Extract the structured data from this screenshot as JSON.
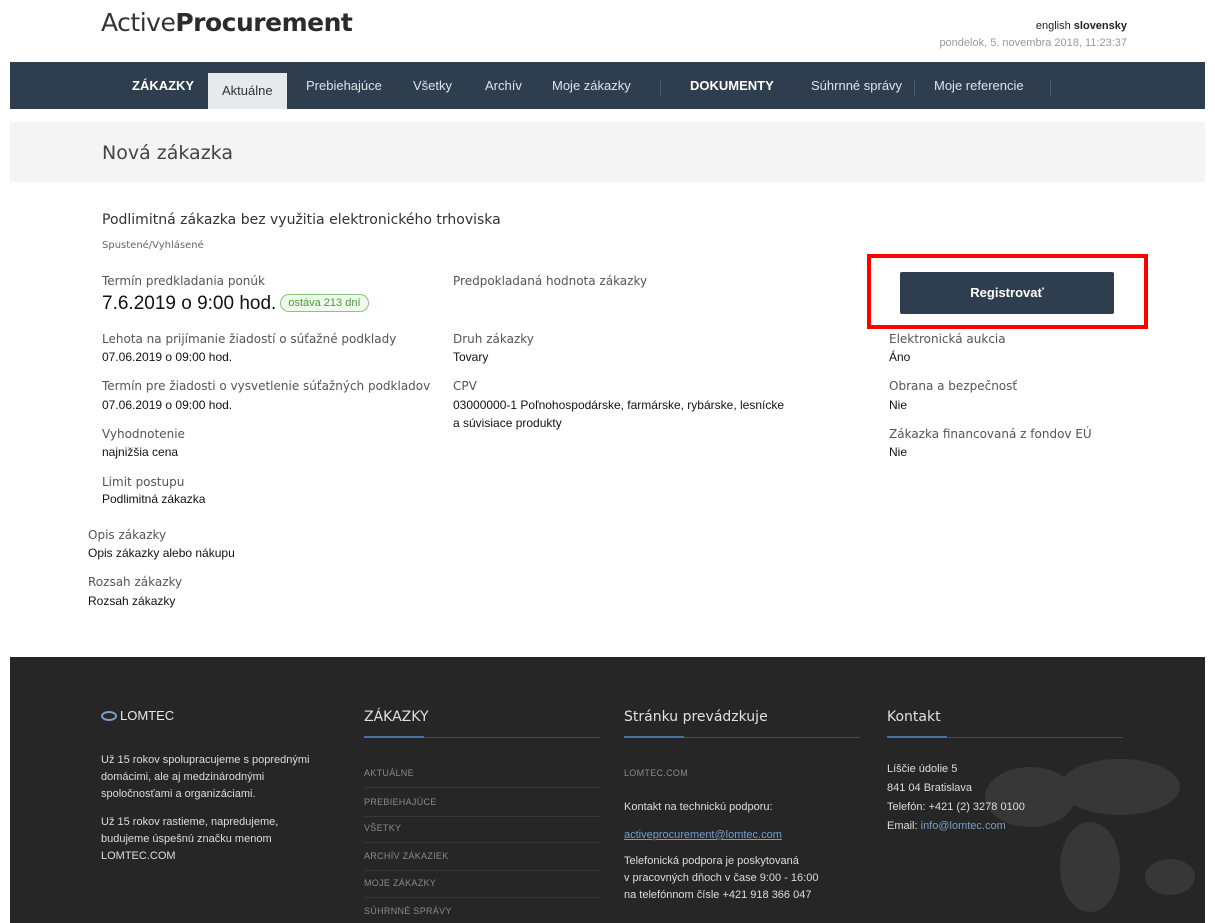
{
  "header": {
    "logo_light": "Active",
    "logo_bold": "Procurement",
    "lang_en": "english",
    "lang_sk": "slovensky",
    "datetime": "pondelok, 5. novembra 2018, 11:23:37"
  },
  "nav": {
    "zakazky": "ZÁKAZKY",
    "aktualne": "Aktuálne",
    "prebiehajuce": "Prebiehajúce",
    "vsetky": "Všetky",
    "archiv": "Archív",
    "moje_zakazky": "Moje zákazky",
    "dokumenty": "DOKUMENTY",
    "suhrnne_spravy": "Súhrnné správy",
    "moje_referencie": "Moje referencie"
  },
  "page": {
    "title": "Nová zákazka",
    "subtitle": "Podlimitná zákazka bez využitia elektronického trhoviska",
    "status": "Spustené/Vyhlásené"
  },
  "details": {
    "termin_label": "Termín predkladania ponúk",
    "termin_value": "7.6.2019 o 9:00 hod.",
    "termin_badge": "ostáva 213 dní",
    "lehota_label": "Lehota na prijímanie žiadostí o súťažné podklady",
    "lehota_value": "07.06.2019 o 09:00 hod.",
    "vysvetlenie_label": "Termín pre žiadosti o vysvetlenie súťažných podkladov",
    "vysvetlenie_value": "07.06.2019 o 09:00 hod.",
    "vyhodnotenie_label": "Vyhodnotenie",
    "vyhodnotenie_value": "najnižšia cena",
    "limit_label": "Limit postupu",
    "limit_value": "Podlimitná zákazka",
    "opis_label": "Opis zákazky",
    "opis_value": "Opis zákazky alebo nákupu",
    "rozsah_label": "Rozsah zákazky",
    "rozsah_value": "Rozsah zákazky",
    "hodnota_label": "Predpokladaná hodnota zákazky",
    "druh_label": "Druh zákazky",
    "druh_value": "Tovary",
    "cpv_label": "CPV",
    "cpv_value_1": "03000000-1 Poľnohospodárske, farmárske, rybárske, lesnícke",
    "cpv_value_2": "a súvisiace produkty",
    "register_button": "Registrovať",
    "aukcia_label": "Elektronická aukcia",
    "aukcia_value": "Áno",
    "obrana_label": "Obrana a bezpečnosť",
    "obrana_value": "Nie",
    "eu_label": "Zákazka financovaná z fondov EÚ",
    "eu_value": "Nie"
  },
  "footer": {
    "brand": "LOMTEC",
    "about_1": "Už 15 rokov spolupracujeme s poprednými",
    "about_2": "domácimi, ale aj medzinárodnými",
    "about_3": "spoločnosťami a organizáciami.",
    "about_4": "Už 15 rokov rastieme, napredujeme,",
    "about_5": "budujeme úspešnú značku menom",
    "about_6": "LOMTEC.COM",
    "col2_title": "ZÁKAZKY",
    "links": [
      "AKTUÁLNE",
      "PREBIEHAJÚCE",
      "VŠETKY",
      "ARCHÍV ZÁKAZIEK",
      "MOJE ZÁKAZKY",
      "SÚHRNNÉ SPRÁVY"
    ],
    "col3_title": "Stránku prevádzkuje",
    "operator": "LOMTEC.COM",
    "support_label": "Kontakt na technickú podporu:",
    "support_email": "activeprocurement@lomtec.com",
    "phone_1": "Telefonická podpora je poskytovaná",
    "phone_2": "v pracovných dňoch v čase 9:00 - 16:00",
    "phone_3": "na telefónnom čísle +421 918 366 047",
    "col4_title": "Kontakt",
    "addr_1": "Líščie údolie 5",
    "addr_2": "841 04 Bratislava",
    "tel": "Telefón:  +421 (2) 3278 0100",
    "email_label": "Email: ",
    "email": "info@lomtec.com"
  },
  "colors": {
    "nav_bg": "#2f3e4e",
    "footer_bg": "#262626",
    "highlight": "#ff0000",
    "badge_green": "#4a9a3a",
    "link_blue": "#7a9cc6"
  }
}
